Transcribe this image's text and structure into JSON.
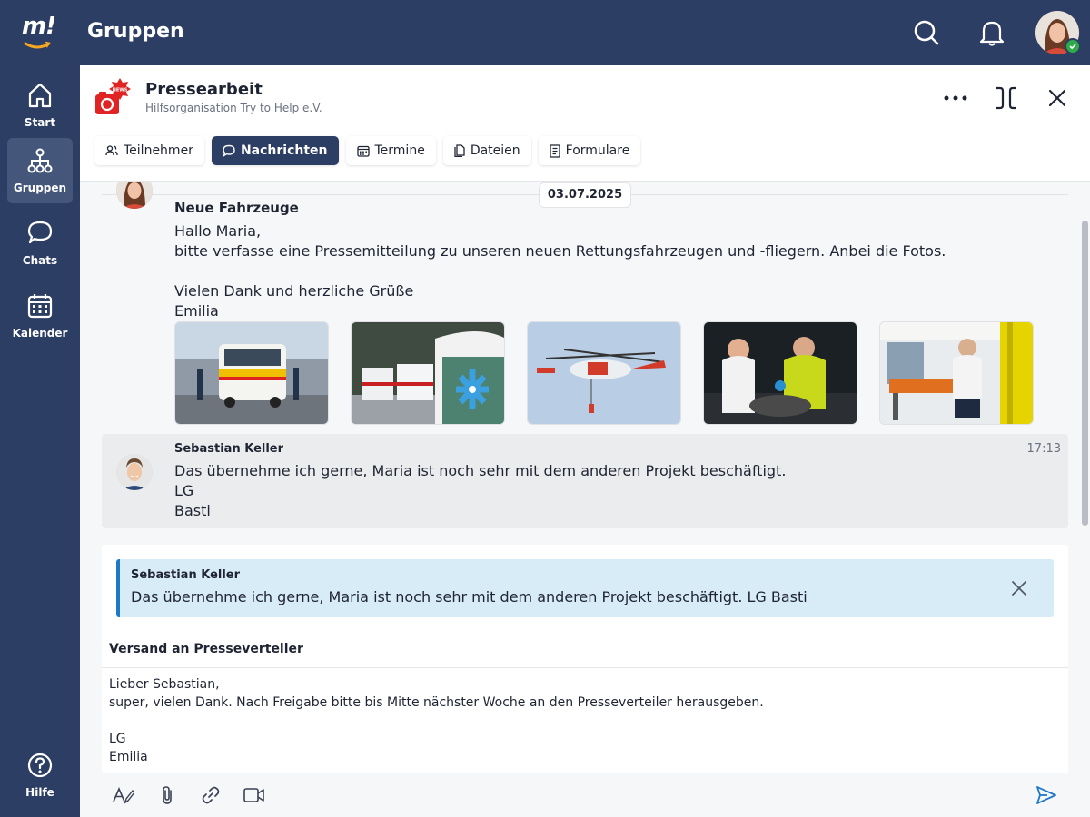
{
  "app": {
    "title": "Gruppen",
    "logo_text": "m!"
  },
  "colors": {
    "navy": "#2c3e63",
    "accent": "#1e78c8",
    "online": "#2eaa4a",
    "brand_red": "#e02424"
  },
  "topbar": {
    "icons": [
      "search-icon",
      "bell-icon"
    ],
    "user_status": "online"
  },
  "sidebar": {
    "items": [
      {
        "label": "Start",
        "icon": "home-icon",
        "active": false
      },
      {
        "label": "Gruppen",
        "icon": "groups-icon",
        "active": true
      },
      {
        "label": "Chats",
        "icon": "chat-icon",
        "active": false
      },
      {
        "label": "Kalender",
        "icon": "calendar-icon",
        "active": false
      },
      {
        "label": "Hilfe",
        "icon": "help-icon",
        "active": false
      }
    ]
  },
  "group": {
    "name": "Pressearbeit",
    "organization": "Hilfsorganisation Try to Help e.V.",
    "badge_text": "NEWS",
    "tabs": [
      {
        "label": "Teilnehmer",
        "icon": "users-icon",
        "active": false
      },
      {
        "label": "Nachrichten",
        "icon": "message-icon",
        "active": true
      },
      {
        "label": "Termine",
        "icon": "calendar-icon",
        "active": false
      },
      {
        "label": "Dateien",
        "icon": "file-icon",
        "active": false
      },
      {
        "label": "Formulare",
        "icon": "form-icon",
        "active": false
      }
    ]
  },
  "chat": {
    "date": "03.07.2025",
    "messages": [
      {
        "subject": "Neue Fahrzeuge",
        "text": "Hallo Maria,\nbitte verfasse eine Pressemitteilung zu unseren neuen Rettungsfahrzeugen und -fliegern. Anbei die Fotos.\n\nVielen Dank und herzliche Grüße\nEmilia",
        "attachments": [
          "ambulance-photo",
          "ambulances-row-photo",
          "rescue-helicopter-photo",
          "paramedics-photo",
          "ambulance-interior-photo"
        ]
      },
      {
        "author": "Sebastian Keller",
        "time": "17:13",
        "text": "Das übernehme ich gerne, Maria ist noch sehr mit dem anderen Projekt beschäftigt.\nLG\nBasti"
      }
    ]
  },
  "composer": {
    "quote_author": "Sebastian Keller",
    "quote_text": "Das übernehme ich gerne, Maria ist noch sehr mit dem anderen Projekt beschäftigt. LG Basti",
    "subject": "Versand an Presseverteiler",
    "body": "Lieber Sebastian,\nsuper, vielen Dank. Nach Freigabe bitte bis Mitte nächster Woche an den Presseverteiler herausgeben.\n\nLG\nEmilia",
    "tools": [
      "text-format-icon",
      "attachment-icon",
      "link-icon",
      "video-icon",
      "send-icon"
    ]
  }
}
